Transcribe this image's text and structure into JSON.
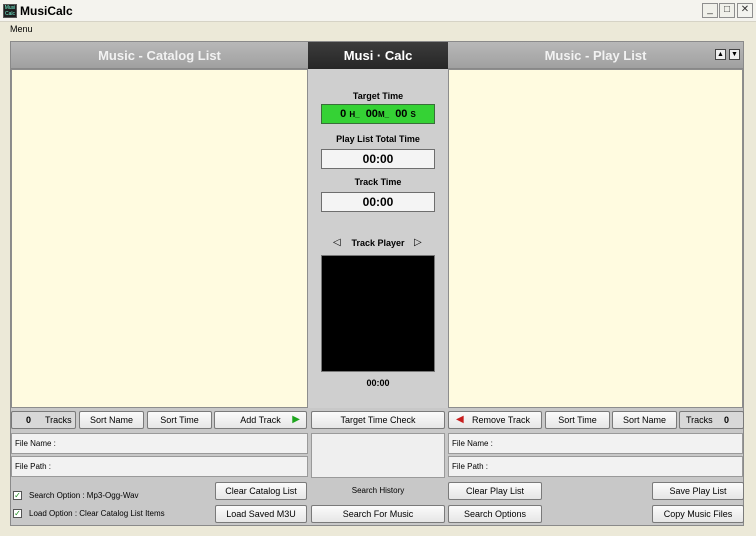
{
  "window": {
    "title": "MusiCalc",
    "icon_text": "Musi Calc",
    "controls": {
      "minimize": "_",
      "maximize": "□",
      "close": "✕"
    }
  },
  "menubar": {
    "menu_label": "Menu"
  },
  "catalog": {
    "header": "Music - Catalog List",
    "tracks_count": "0",
    "tracks_label": "Tracks",
    "sort_name": "Sort Name",
    "sort_time": "Sort Time",
    "add_track": "Add Track",
    "file_name_label": "File Name :",
    "file_path_label": "File Path :",
    "clear_catalog": "Clear Catalog List",
    "load_m3u": "Load Saved M3U",
    "search_option": "Search Option : Mp3-Ogg-Wav",
    "load_option": "Load Option : Clear Catalog List Items"
  },
  "center": {
    "header": "Musi · Calc",
    "target_time_label": "Target Time",
    "target_h": "0",
    "target_h_unit": "H_",
    "target_m": "00",
    "target_m_unit": "M_",
    "target_s": "00",
    "target_s_unit": "S",
    "play_list_total_label": "Play List Total Time",
    "play_list_total_value": "00:00",
    "track_time_label": "Track Time",
    "track_time_value": "00:00",
    "track_player_label": "Track Player",
    "player_time": "00:00",
    "target_time_check": "Target Time Check",
    "search_history": "Search History",
    "search_for_music": "Search For Music"
  },
  "playlist": {
    "header": "Music - Play List",
    "remove_track": "Remove Track",
    "sort_time": "Sort Time",
    "sort_name": "Sort Name",
    "tracks_label": "Tracks",
    "tracks_count": "0",
    "file_name_label": "File Name :",
    "file_path_label": "File Path :",
    "clear_play_list": "Clear Play List",
    "search_options": "Search Options",
    "save_play_list": "Save Play List",
    "copy_music_files": "Copy Music Files"
  },
  "colors": {
    "list_background": "#fffbe0",
    "target_time_background": "#35d235",
    "add_arrow": "#1ea51e",
    "remove_arrow": "#c81e1e"
  }
}
